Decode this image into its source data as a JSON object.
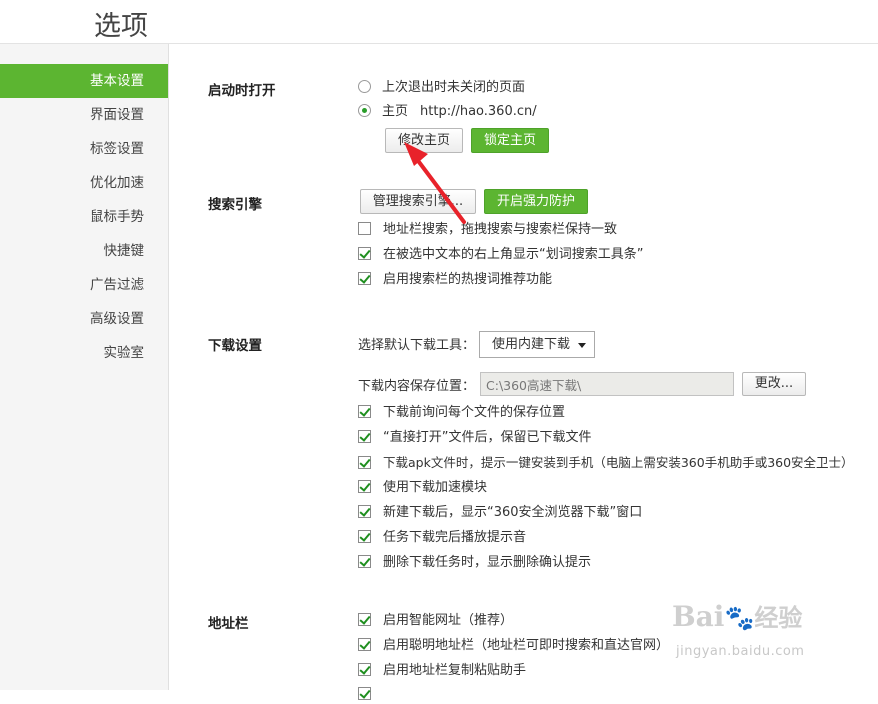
{
  "window": {
    "title": "选项"
  },
  "sidebar": {
    "items": [
      {
        "label": "基本设置",
        "active": true
      },
      {
        "label": "界面设置"
      },
      {
        "label": "标签设置"
      },
      {
        "label": "优化加速"
      },
      {
        "label": "鼠标手势"
      },
      {
        "label": "快捷键"
      },
      {
        "label": "广告过滤"
      },
      {
        "label": "高级设置"
      },
      {
        "label": "实验室"
      }
    ]
  },
  "startup": {
    "title": "启动时打开",
    "options": [
      {
        "label": "上次退出时未关闭的页面",
        "checked": false
      },
      {
        "label": "主页",
        "url": "http://hao.360.cn/",
        "checked": true
      }
    ],
    "modify_button": "修改主页",
    "lock_button": "锁定主页"
  },
  "search": {
    "title": "搜索引擎",
    "manage_button": "管理搜索引擎...",
    "protect_button": "开启强力防护",
    "checks": [
      {
        "label": "地址栏搜索，拖拽搜索与搜索栏保持一致",
        "checked": false
      },
      {
        "label": "在被选中文本的右上角显示“划词搜索工具条”",
        "checked": true
      },
      {
        "label": "启用搜索栏的热搜词推荐功能",
        "checked": true
      }
    ]
  },
  "download": {
    "title": "下载设置",
    "tool_label": "选择默认下载工具：",
    "tool_value": "使用内建下载",
    "path_label": "下载内容保存位置：",
    "path_value": "C:\\360高速下载\\",
    "change_button": "更改...",
    "checks": [
      {
        "label": "下载前询问每个文件的保存位置",
        "checked": true
      },
      {
        "label": "“直接打开”文件后，保留已下载文件",
        "checked": true
      },
      {
        "label": "下载apk文件时，提示一键安装到手机（电脑上需安装360手机助手或360安全卫士）",
        "checked": true
      },
      {
        "label": "使用下载加速模块",
        "checked": true
      },
      {
        "label": "新建下载后，显示“360安全浏览器下载”窗口",
        "checked": true
      },
      {
        "label": "任务下载完后播放提示音",
        "checked": true
      },
      {
        "label": "删除下载任务时，显示删除确认提示",
        "checked": true
      }
    ]
  },
  "addressbar": {
    "title": "地址栏",
    "checks": [
      {
        "label": "启用智能网址（推荐）",
        "checked": true
      },
      {
        "label": "启用聪明地址栏（地址栏可即时搜索和直达官网）",
        "checked": true
      },
      {
        "label": "启用地址栏复制粘贴助手",
        "checked": true
      }
    ]
  },
  "watermark": {
    "logo_left": "Bai",
    "logo_right": "经验",
    "site": "jingyan.baidu.com"
  },
  "colors": {
    "accent_green": "#5cb531",
    "annotation_red": "#e8222a"
  }
}
